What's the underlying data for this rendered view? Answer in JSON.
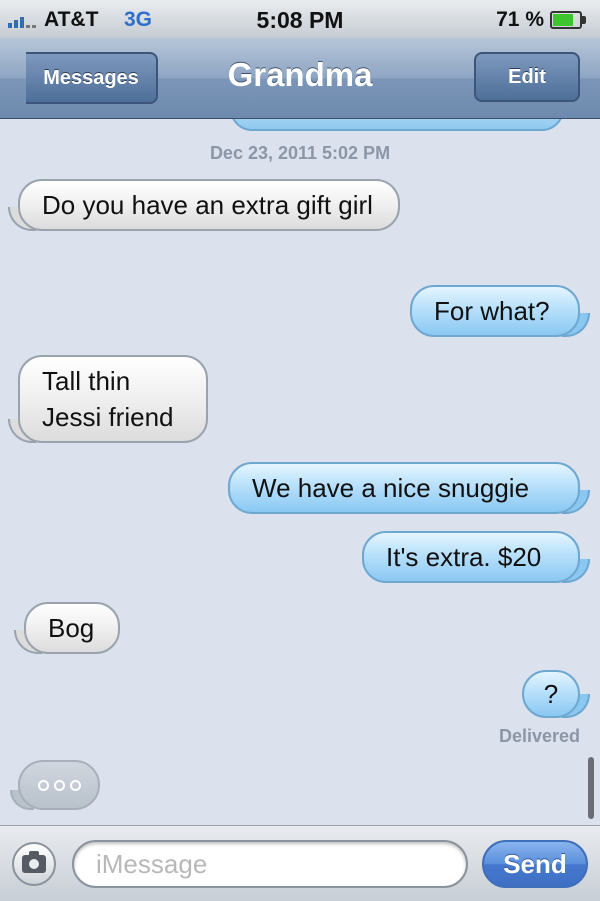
{
  "status_bar": {
    "carrier": "AT&T",
    "network": "3G",
    "time": "5:08 PM",
    "battery_percent": "71 %",
    "battery_level": 0.71
  },
  "nav": {
    "back_label": "Messages",
    "title": "Grandma",
    "edit_label": "Edit"
  },
  "conversation": {
    "timestamp": "Dec 23, 2011 5:02 PM",
    "messages": [
      {
        "direction": "incoming",
        "text": "Do you have an extra gift girl"
      },
      {
        "direction": "outgoing",
        "text": "For what?"
      },
      {
        "direction": "incoming",
        "text": "Tall thin Jessi friend"
      },
      {
        "direction": "outgoing",
        "text": "We have a nice snuggie"
      },
      {
        "direction": "outgoing",
        "text": "It's extra. $20"
      },
      {
        "direction": "incoming",
        "text": "Bog"
      },
      {
        "direction": "outgoing",
        "text": "?"
      }
    ],
    "delivered_label": "Delivered"
  },
  "input_bar": {
    "placeholder": "iMessage",
    "send_label": "Send"
  },
  "colors": {
    "background": "#dbe2ed",
    "outgoing_bubble": "#8ac8f2",
    "incoming_bubble": "#f1f1f1",
    "send_button": "#4579cf"
  }
}
